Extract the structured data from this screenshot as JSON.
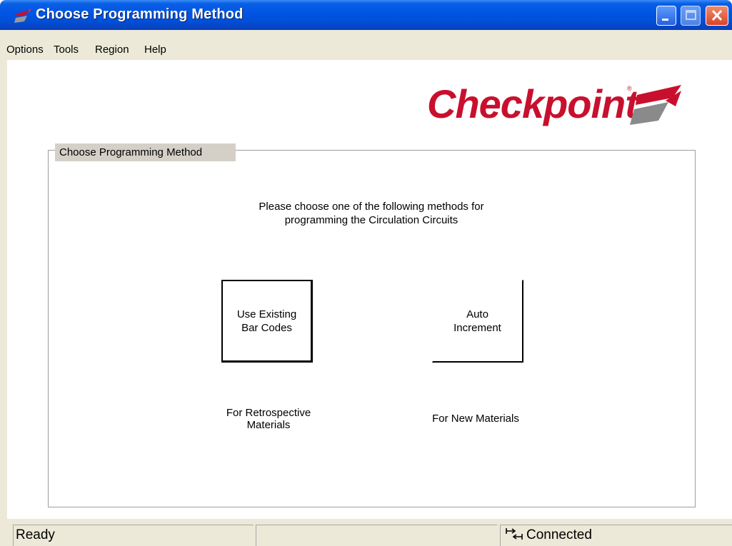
{
  "window": {
    "title": "Choose Programming Method"
  },
  "menu": {
    "items": [
      "Options",
      "Tools",
      "Region",
      "Help"
    ]
  },
  "logo": {
    "text": "Checkpoint",
    "color": "#c8102e"
  },
  "group": {
    "legend": "Choose Programming Method",
    "instruction_line1": "Please choose one of the following methods for",
    "instruction_line2": "programming the Circulation Circuits"
  },
  "buttons": {
    "existing": {
      "line1": "Use Existing",
      "line2": "Bar Codes"
    },
    "auto": {
      "line1": "Auto",
      "line2": "Increment"
    }
  },
  "captions": {
    "existing": "For Retrospective\nMaterials",
    "auto": "For New Materials"
  },
  "status": {
    "left": "Ready",
    "middle": "",
    "right": "Connected"
  },
  "icons": {
    "app": "checkpoint-logo-icon",
    "minimize": "minimize-icon",
    "maximize": "maximize-icon",
    "close": "close-icon",
    "connection": "connection-arrows-icon"
  }
}
